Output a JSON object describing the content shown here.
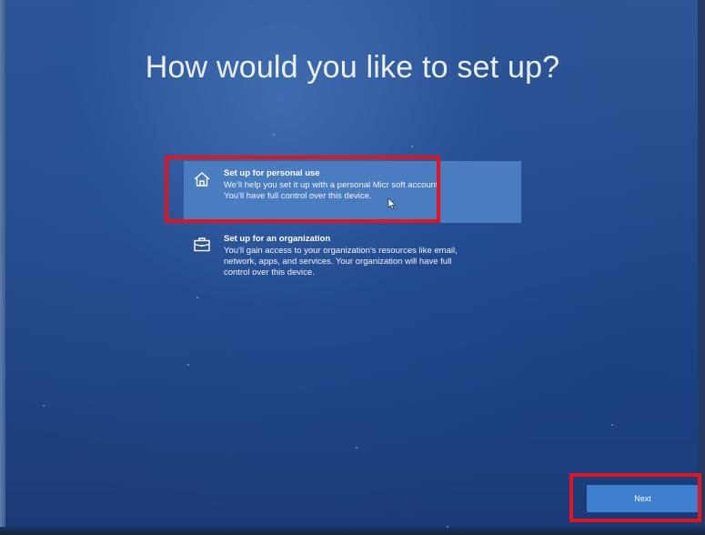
{
  "page": {
    "title": "How would you like to set up?"
  },
  "options": [
    {
      "heading": "Set up for personal use",
      "description_line1": "We'll help you set it up with a personal Micr soft account.",
      "description_line2": "You'll have full control over this device.",
      "icon": "home-icon",
      "selected": true
    },
    {
      "heading": "Set up for an organization",
      "description_line1": "You'll gain access to your organization's resources like email,",
      "description_line2": "network, apps, and services. Your organization will have full",
      "description_line3": "control over this device.",
      "icon": "briefcase-icon",
      "selected": false
    }
  ],
  "footer": {
    "next_label": "Next"
  },
  "colors": {
    "background": "#254b8c",
    "selected_option": "#4a7cc0",
    "next_button": "#3f7fd0",
    "annotation_red": "#e0151f"
  }
}
